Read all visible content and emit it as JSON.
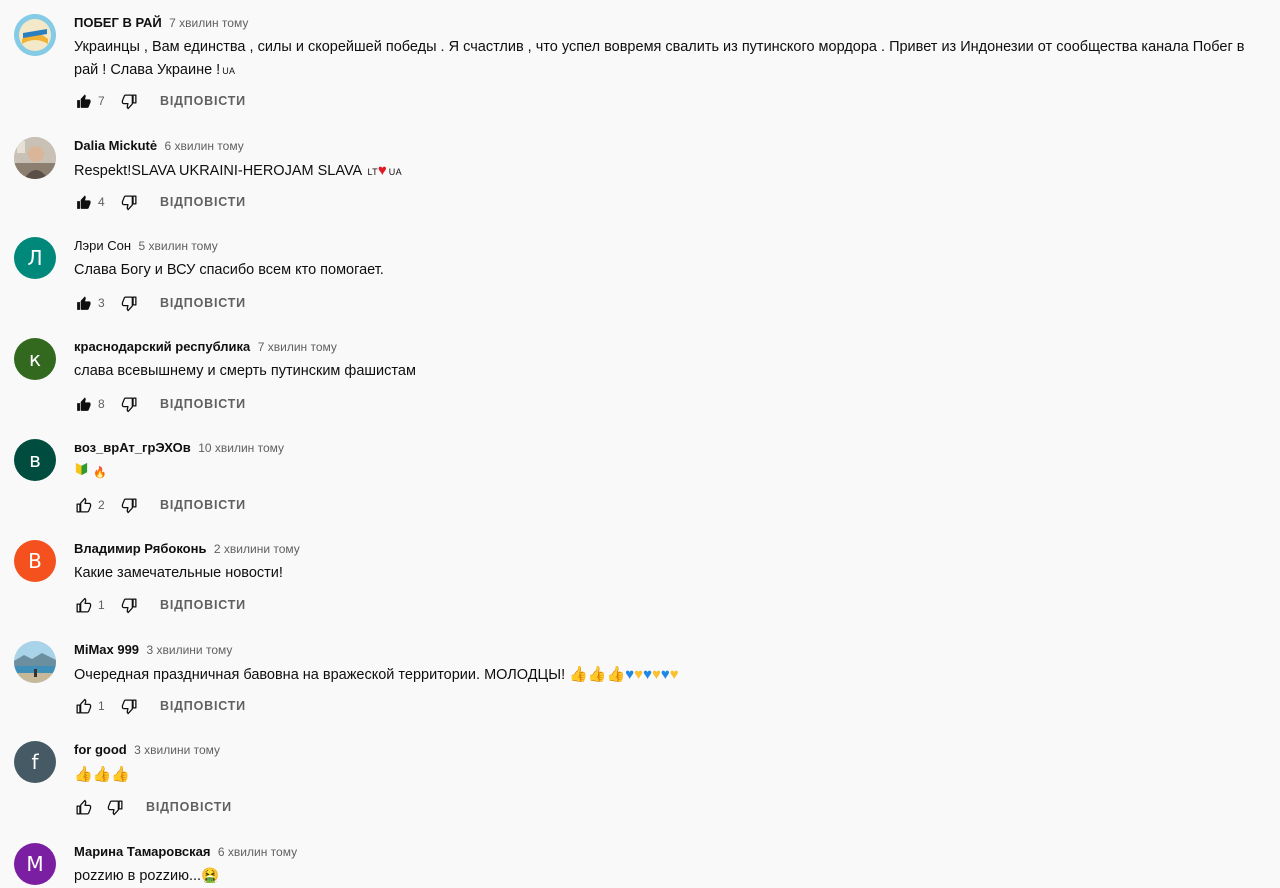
{
  "reply_label": "ВІДПОВІСТИ",
  "colors": {
    "background": "#f9f9f9",
    "text_primary": "#0f0f0f",
    "text_secondary": "#606060",
    "avatar_teal": "#00897b",
    "avatar_green": "#33691e",
    "avatar_darkgreen": "#004d40",
    "avatar_orange": "#f4511e",
    "avatar_slate": "#455a64",
    "avatar_purple": "#7b1fa2"
  },
  "comments": [
    {
      "author": "ПОБЕГ В РАЙ",
      "time": "7 хвилин тому",
      "text": "Украинцы , Вам единства , силы и скорейшей победы . Я счастлив , что успел вовремя свалить из путинского мордора . Привет из Индонезии от сообщества канала Побег в рай ! Слава Украине !",
      "flag": "UA",
      "likes": "7",
      "liked": true,
      "avatar": {
        "type": "image",
        "icon": "channel-logo-icon"
      }
    },
    {
      "author": "Dalia Mickutė",
      "time": "6 хвилин тому",
      "text": "Respekt!SLAVA UKRAINI-HEROJAM SLAVA",
      "flag_1": "LT",
      "flag_2": "UA",
      "likes": "4",
      "liked": true,
      "avatar": {
        "type": "image",
        "icon": "profile-photo-icon"
      }
    },
    {
      "author": "Лэри Сон",
      "time": "5 хвилин тому",
      "text": "Слава Богу и ВСУ спасибо всем кто помогает.",
      "likes": "3",
      "liked": true,
      "avatar": {
        "type": "letter",
        "letter": "Л"
      }
    },
    {
      "author": "краснодарский республика",
      "time": "7 хвилин тому",
      "text": "слава всевышнему и смерть путинским фашистам",
      "likes": "8",
      "liked": true,
      "avatar": {
        "type": "letter",
        "letter": "к"
      }
    },
    {
      "author": "воз_врАт_грЭХОв",
      "time": "10 хвилин тому",
      "likes": "2",
      "liked": false,
      "avatar": {
        "type": "letter",
        "letter": "в"
      }
    },
    {
      "author": "Владимир Рябоконь",
      "time": "2 хвилини тому",
      "text": "Какие замечательные новости!",
      "likes": "1",
      "liked": false,
      "avatar": {
        "type": "letter",
        "letter": "В"
      }
    },
    {
      "author": "MiMax 999",
      "time": "3 хвилини тому",
      "text": "Очередная праздничная бавовна на вражеской территории. МОЛОДЦЫ!",
      "likes": "1",
      "liked": false,
      "avatar": {
        "type": "image",
        "icon": "landscape-photo-icon"
      }
    },
    {
      "author": "for good",
      "time": "3 хвилини тому",
      "liked": false,
      "avatar": {
        "type": "letter",
        "letter": "f"
      }
    },
    {
      "author": "Марина Тамаровская",
      "time": "6 хвилин тому",
      "text": "рozzию в  рozzию...",
      "avatar": {
        "type": "letter",
        "letter": "М"
      }
    }
  ]
}
